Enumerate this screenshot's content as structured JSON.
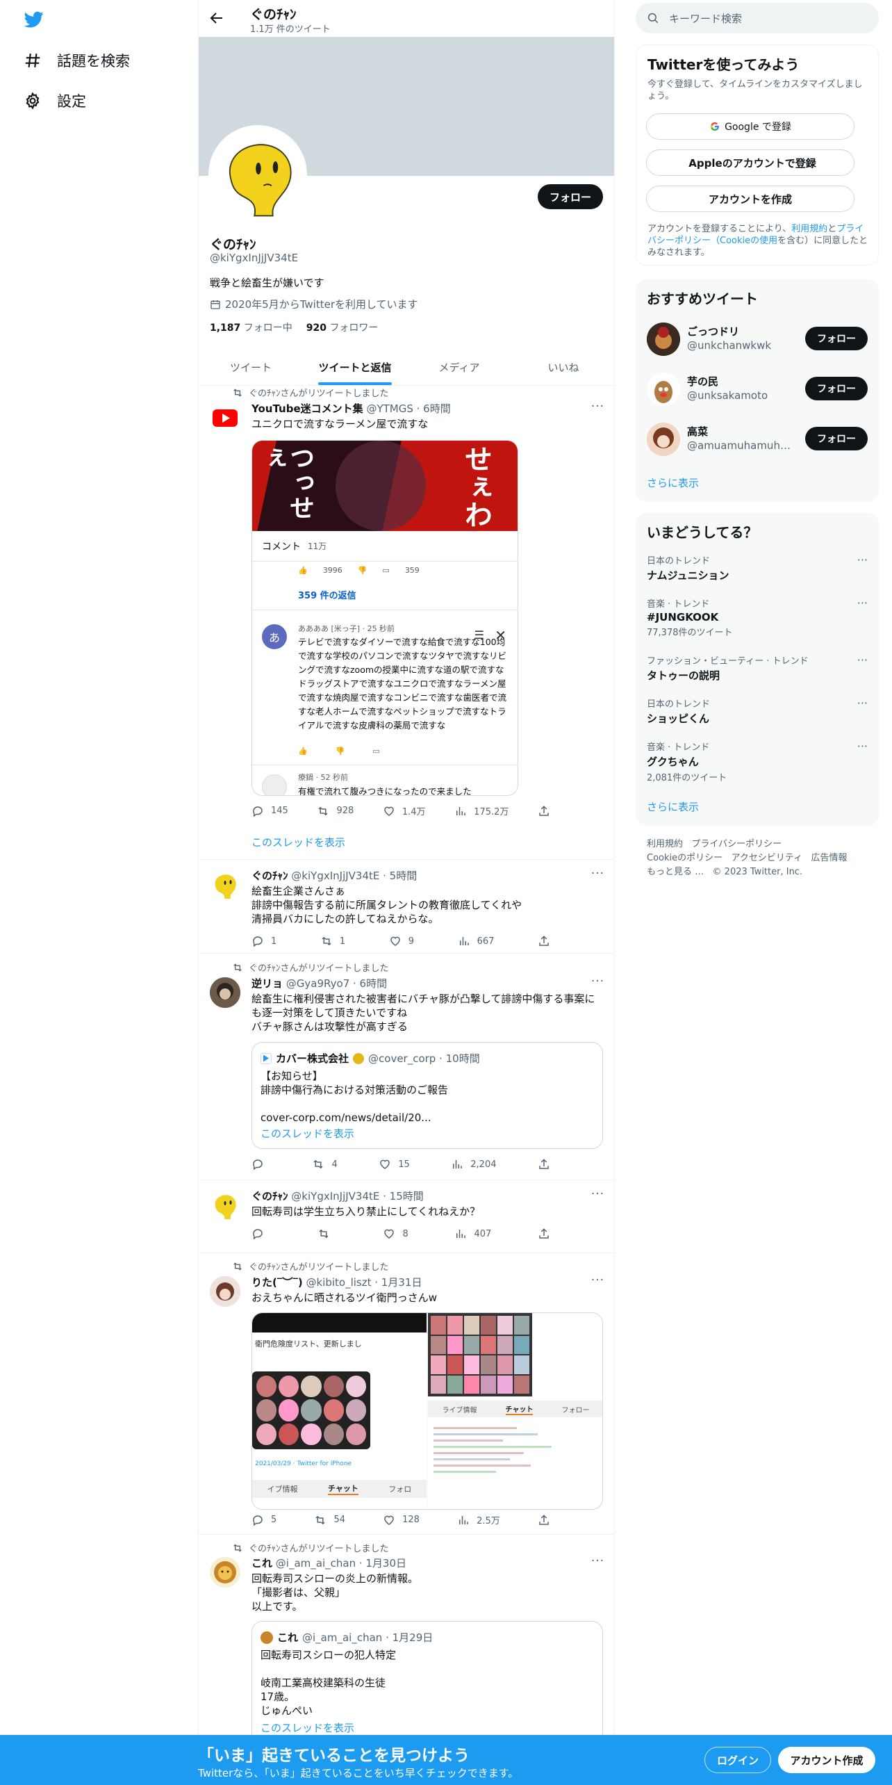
{
  "nav": {
    "explore": "話題を検索",
    "settings": "設定"
  },
  "header": {
    "title": "ぐのﾁｬﾝ",
    "subtitle": "1.1万 件のツイート"
  },
  "profile": {
    "follow": "フォロー",
    "name": "ぐのﾁｬﾝ",
    "handle": "@kiYgxInJjJV34tE",
    "bio": "戦争と絵畜生が嫌いです",
    "joined": "2020年5月からTwitterを利用しています",
    "following_count": "1,187",
    "following_label": "フォロー中",
    "followers_count": "920",
    "followers_label": "フォロワー"
  },
  "tabs": [
    "ツイート",
    "ツイートと返信",
    "メディア",
    "いいね"
  ],
  "tweets": [
    {
      "rt": "ぐのﾁｬﾝさんがリツイートしました",
      "name": "YouTube迷コメント集",
      "handle": "@YTMGS · 6時間",
      "text": "ユニクロで流すなラーメン屋で流すな",
      "card": {
        "vid_a": "つっせぇ",
        "vid_b": "せぇわ",
        "comments_label": "コメント",
        "comments_count": "11万",
        "likes": "3996",
        "replies": "359",
        "reply_link": "359 件の返信",
        "c_author": "ああああ [米っ子] · 25 秒前",
        "c_text": "テレビで流すなダイソーで流すな給食で流すな100均で流すな学校のパソコンで流すなツタヤで流すなリビングで流すなzoomの授業中に流すな道の駅で流すなドラッグストアで流すなユニクロで流すなラーメン屋で流すな焼肉屋で流すなコンビニで流すな歯医者で流すな老人ホームで流すなペットショップで流すなトライアルで流すな皮膚科の薬局で流すな",
        "c2_author": "療鍋 · 52 秒前",
        "c2_text": "有権で流れて腹みつきになったので来ました"
      },
      "stats": {
        "reply": "145",
        "rt": "928",
        "like": "1.4万",
        "views": "175.2万"
      },
      "thread": "このスレッドを表示"
    },
    {
      "name": "ぐのﾁｬﾝ",
      "handle": "@kiYgxInJjJV34tE · 5時間",
      "lines": [
        "絵畜生企業さんさぁ",
        "誹謗中傷報告する前に所属タレントの教育徹底してくれや",
        "清掃員バカにしたの許してねえからな。"
      ],
      "stats": {
        "reply": "1",
        "rt": "1",
        "like": "9",
        "views": "667"
      }
    },
    {
      "rt": "ぐのﾁｬﾝさんがリツイートしました",
      "name": "逆リョ",
      "handle": "@Gya9Ryo7 · 6時間",
      "lines": [
        "絵畜生に権利侵害された被害者にバチャ豚が凸撃して誹謗中傷する事案にも逐一対策をして頂きたいですね",
        "バチャ豚さんは攻撃性が高すぎる"
      ],
      "quote": {
        "name": "カバー株式会社",
        "handle": "@cover_corp · 10時間",
        "lines": [
          "【お知らせ】",
          "誹謗中傷行為における対策活動のご報告",
          "",
          "cover-corp.com/news/detail/20..."
        ],
        "thread": "このスレッドを表示"
      },
      "stats": {
        "reply": "",
        "rt": "4",
        "like": "15",
        "views": "2,204"
      }
    },
    {
      "name": "ぐのﾁｬﾝ",
      "handle": "@kiYgxInJjJV34tE · 15時間",
      "text": "回転寿司は学生立ち入り禁止にしてくれねえか？",
      "stats": {
        "reply": "",
        "rt": "",
        "like": "8",
        "views": "407"
      }
    },
    {
      "rt": "ぐのﾁｬﾝさんがリツイートしました",
      "name": "りた(‾︶‾)",
      "handle": "@kibito_liszt · 1月31日",
      "text": "おえちゃんに晒されるツイ衛門っさんw",
      "media": {
        "left_caption": "衛門危険度リスト、更新しまし",
        "left_tabs": [
          "イブ情報",
          "チャット",
          "フォロ"
        ],
        "right_tabs": [
          "ライブ情報",
          "チャット",
          "フォロー"
        ],
        "left_footer": "2021/03/29 · Twitter for iPhone"
      },
      "stats": {
        "reply": "5",
        "rt": "54",
        "like": "128",
        "views": "2.5万"
      }
    },
    {
      "rt": "ぐのﾁｬﾝさんがリツイートしました",
      "name": "これ",
      "handle": "@i_am_ai_chan · 1月30日",
      "lines": [
        "回転寿司スシローの炎上の新情報。",
        "「撮影者は、父親」",
        "以上です。"
      ],
      "quote": {
        "name": "これ",
        "handle": "@i_am_ai_chan · 1月29日",
        "lines": [
          "回転寿司スシローの犯人特定",
          "",
          "岐南工業高校建築科の生徒",
          "17歳。",
          "じゅんぺい"
        ],
        "thread": "このスレッドを表示"
      }
    }
  ],
  "right": {
    "search_placeholder": "キーワード検索",
    "signup": {
      "title": "Twitterを使ってみよう",
      "desc": "今すぐ登録して、タイムラインをカスタマイズしましょう。",
      "google": "Google で登録",
      "apple": "Appleのアカウントで登録",
      "create": "アカウントを作成",
      "legal_prefix": "アカウントを登録することにより、",
      "legal_terms": "利用規約",
      "legal_mid": "と",
      "legal_privacy": "プライバシーポリシー（Cookieの使用",
      "legal_suffix": "を含む）に同意したとみなされます。"
    },
    "recommend": {
      "title": "おすすめツイート",
      "users": [
        {
          "name": "ごっつドリ",
          "handle": "@unkchanwkwk",
          "btn": "フォロー"
        },
        {
          "name": "芋の民",
          "handle": "@unksakamoto",
          "btn": "フォロー"
        },
        {
          "name": "高菜",
          "handle": "@amuamuhamuham...",
          "btn": "フォロー"
        }
      ],
      "more": "さらに表示"
    },
    "trends": {
      "title": "いまどうしてる？",
      "items": [
        {
          "ctx": "日本のトレンド",
          "title": "ナムジュニション",
          "count": ""
        },
        {
          "ctx": "音楽 · トレンド",
          "title": "#JUNGKOOK",
          "count": "77,378件のツイート"
        },
        {
          "ctx": "ファッション・ビューティー · トレンド",
          "title": "タトゥーの説明",
          "count": ""
        },
        {
          "ctx": "日本のトレンド",
          "title": "ショッピくん",
          "count": ""
        },
        {
          "ctx": "音楽 · トレンド",
          "title": "グクちゃん",
          "count": "2,081件のツイート"
        }
      ],
      "more": "さらに表示"
    },
    "footer": {
      "terms": "利用規約",
      "privacy": "プライバシーポリシー",
      "cookie": "Cookieのポリシー",
      "accessibility": "アクセシビリティ",
      "ads": "広告情報",
      "more": "もっと見る …",
      "copyright": "© 2023 Twitter, Inc."
    }
  },
  "bottom": {
    "title": "「いま」起きていることを見つけよう",
    "sub": "Twitterなら、「いま」起きていることをいち早くチェックできます。",
    "login": "ログイン",
    "signup": "アカウント作成"
  },
  "colors": {
    "accent": "#1d9bf0",
    "text": "#0f1419",
    "muted": "#536471",
    "banner": "#cfd9de"
  }
}
